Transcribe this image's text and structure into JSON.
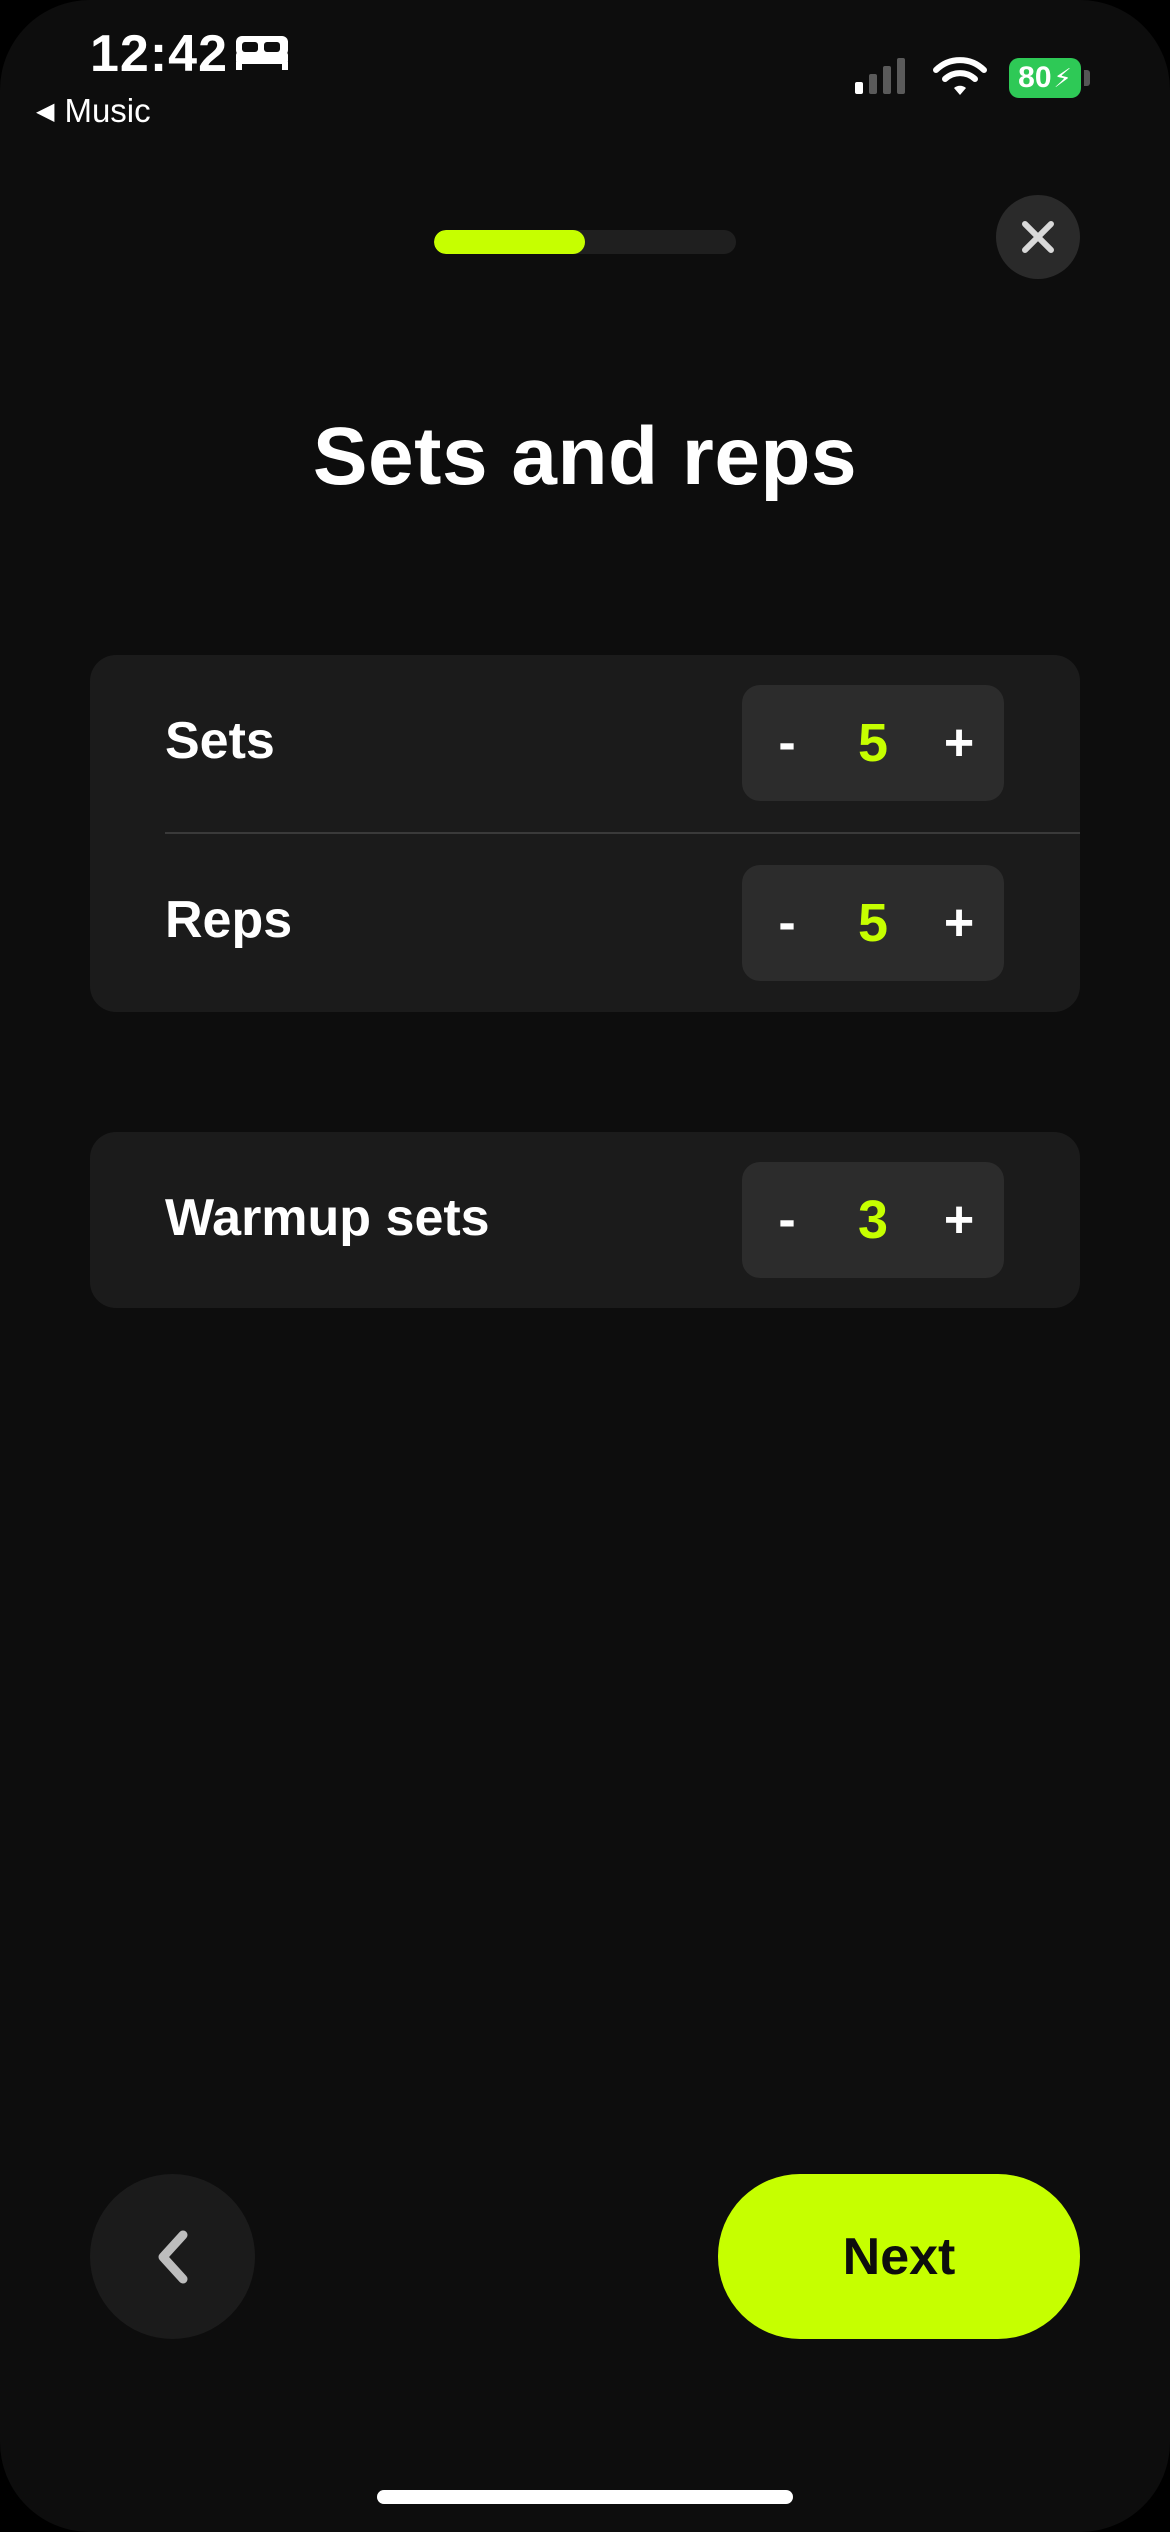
{
  "status_bar": {
    "time": "12:42",
    "back_app": "Music",
    "battery": "80"
  },
  "progress": {
    "fraction": 0.5
  },
  "page": {
    "title": "Sets and reps"
  },
  "settings": [
    {
      "label": "Sets",
      "value": "5",
      "minus": "-",
      "plus": "+"
    },
    {
      "label": "Reps",
      "value": "5",
      "minus": "-",
      "plus": "+"
    },
    {
      "label": "Warmup sets",
      "value": "3",
      "minus": "-",
      "plus": "+"
    }
  ],
  "footer": {
    "next_label": "Next"
  },
  "colors": {
    "accent": "#c6ff00",
    "background": "#0d0d0d",
    "card": "#1b1b1b",
    "stepper": "#2c2c2c"
  }
}
